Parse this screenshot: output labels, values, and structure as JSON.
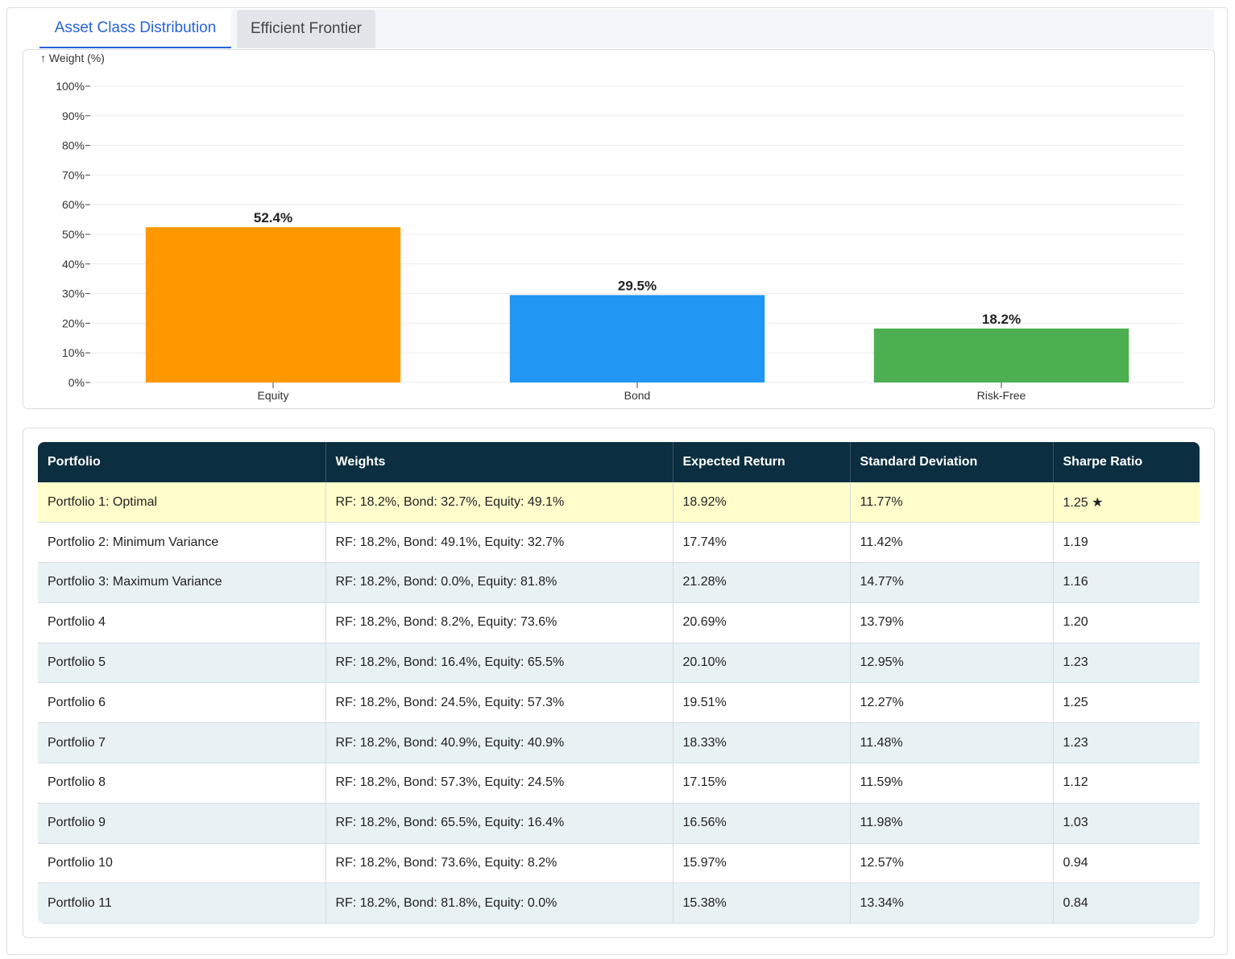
{
  "tabs": [
    {
      "label": "Asset Class Distribution",
      "active": true
    },
    {
      "label": "Efficient Frontier",
      "active": false
    }
  ],
  "chart_data": {
    "type": "bar",
    "ylabel": "↑ Weight (%)",
    "categories": [
      "Equity",
      "Bond",
      "Risk-Free"
    ],
    "values": [
      52.4,
      29.5,
      18.2
    ],
    "value_labels": [
      "52.4%",
      "29.5%",
      "18.2%"
    ],
    "colors": [
      "#ff9800",
      "#2196f3",
      "#4caf50"
    ],
    "ylim": [
      0,
      100
    ],
    "yticks": [
      0,
      10,
      20,
      30,
      40,
      50,
      60,
      70,
      80,
      90,
      100
    ],
    "ytick_labels": [
      "0%",
      "10%",
      "20%",
      "30%",
      "40%",
      "50%",
      "60%",
      "70%",
      "80%",
      "90%",
      "100%"
    ],
    "grid": true
  },
  "table": {
    "headers": [
      "Portfolio",
      "Weights",
      "Expected Return",
      "Standard Deviation",
      "Sharpe Ratio"
    ],
    "rows": [
      [
        "Portfolio 1: Optimal",
        "RF: 18.2%, Bond: 32.7%, Equity: 49.1%",
        "18.92%",
        "11.77%",
        "1.25 ★"
      ],
      [
        "Portfolio 2: Minimum Variance",
        "RF: 18.2%, Bond: 49.1%, Equity: 32.7%",
        "17.74%",
        "11.42%",
        "1.19"
      ],
      [
        "Portfolio 3: Maximum Variance",
        "RF: 18.2%, Bond: 0.0%, Equity: 81.8%",
        "21.28%",
        "14.77%",
        "1.16"
      ],
      [
        "Portfolio 4",
        "RF: 18.2%, Bond: 8.2%, Equity: 73.6%",
        "20.69%",
        "13.79%",
        "1.20"
      ],
      [
        "Portfolio 5",
        "RF: 18.2%, Bond: 16.4%, Equity: 65.5%",
        "20.10%",
        "12.95%",
        "1.23"
      ],
      [
        "Portfolio 6",
        "RF: 18.2%, Bond: 24.5%, Equity: 57.3%",
        "19.51%",
        "12.27%",
        "1.25"
      ],
      [
        "Portfolio 7",
        "RF: 18.2%, Bond: 40.9%, Equity: 40.9%",
        "18.33%",
        "11.48%",
        "1.23"
      ],
      [
        "Portfolio 8",
        "RF: 18.2%, Bond: 57.3%, Equity: 24.5%",
        "17.15%",
        "11.59%",
        "1.12"
      ],
      [
        "Portfolio 9",
        "RF: 18.2%, Bond: 65.5%, Equity: 16.4%",
        "16.56%",
        "11.98%",
        "1.03"
      ],
      [
        "Portfolio 10",
        "RF: 18.2%, Bond: 73.6%, Equity: 8.2%",
        "15.97%",
        "12.57%",
        "0.94"
      ],
      [
        "Portfolio 11",
        "RF: 18.2%, Bond: 81.8%, Equity: 0.0%",
        "15.38%",
        "13.34%",
        "0.84"
      ]
    ],
    "highlight_row": 0,
    "header_color": "#0b2e40",
    "highlight_color": "#ffffcc",
    "stripe_color": "#e8f1f3"
  }
}
